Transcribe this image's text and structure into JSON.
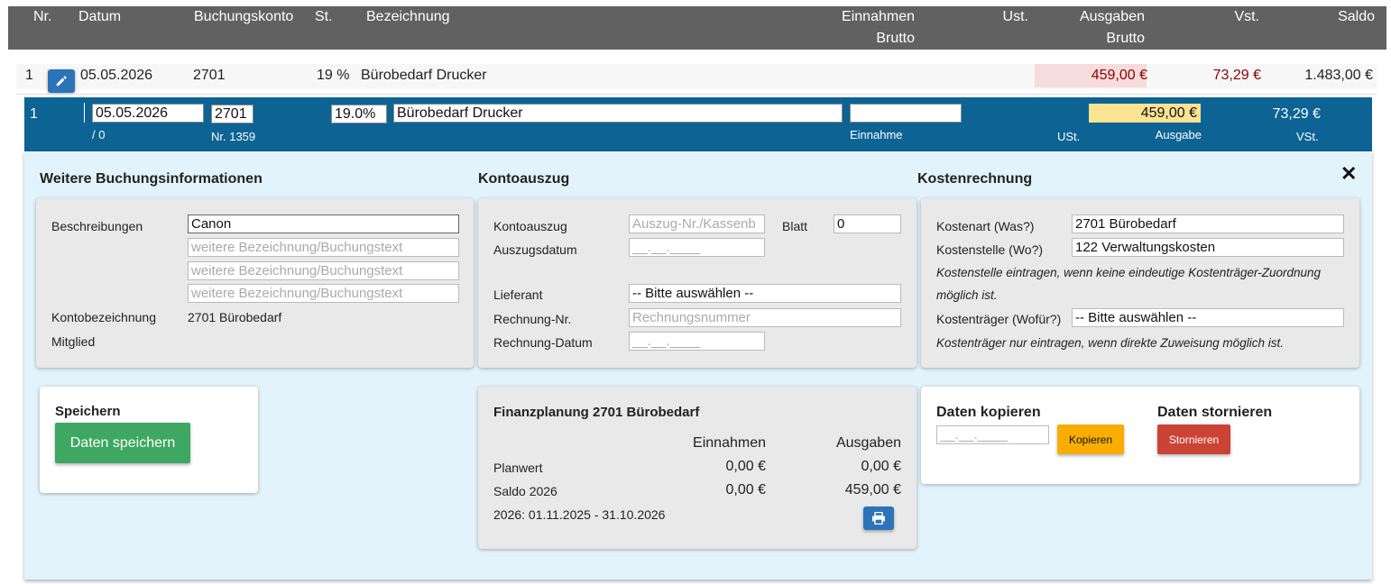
{
  "header": {
    "nr": "Nr.",
    "datum": "Datum",
    "buchungskonto": "Buchungskonto",
    "st": "St.",
    "bezeichnung": "Bezeichnung",
    "einnahmen": "Einnahmen",
    "einnahmen_brutto": "Brutto",
    "ust": "Ust.",
    "ausgaben": "Ausgaben",
    "ausgaben_brutto": "Brutto",
    "vst": "Vst.",
    "saldo": "Saldo"
  },
  "row": {
    "nr": "1",
    "datum": "05.05.2026",
    "konto": "2701",
    "steuer": "19 %",
    "bezeichnung": "Bürobedarf Drucker",
    "ausgaben": "459,00 €",
    "vst": "73,29 €",
    "saldo": "1.483,00 €"
  },
  "edit": {
    "nr": "1",
    "datum": "05.05.2026",
    "sub_datum": "/ 0",
    "konto": "2701",
    "konto_nr": "Nr. 1359",
    "steuer": "19.0%",
    "bezeichnung": "Bürobedarf Drucker",
    "einnahme": "",
    "einnahme_label": "Einnahme",
    "ust_label": "USt.",
    "ausgabe": "459,00 €",
    "ausgabe_label": "Ausgabe",
    "vst_value": "73,29 €",
    "vst_label": "VSt."
  },
  "weitere": {
    "title": "Weitere Buchungsinformationen",
    "beschreibungen_label": "Beschreibungen",
    "beschreibung1": "Canon",
    "placeholder": "weitere Bezeichnung/Buchungstext",
    "kontobezeichnung_label": "Kontobezeichnung",
    "kontobezeichnung_value": "2701 Bürobedarf",
    "mitglied_label": "Mitglied"
  },
  "kontoauszug": {
    "title": "Kontoauszug",
    "kontoauszug_label": "Kontoauszug",
    "kontoauszug_placeholder": "Auszug-Nr./Kassenb",
    "blatt_label": "Blatt",
    "blatt_value": "0",
    "auszugsdatum_label": "Auszugsdatum",
    "date_placeholder": "__.__.____",
    "lieferant_label": "Lieferant",
    "lieferant_value": "-- Bitte auswählen --",
    "rechnung_nr_label": "Rechnung-Nr.",
    "rechnung_nr_placeholder": "Rechnungsnummer",
    "rechnung_datum_label": "Rechnung-Datum"
  },
  "kosten": {
    "title": "Kostenrechnung",
    "kostenart_label": "Kostenart (Was?)",
    "kostenart_value": "2701 Bürobedarf",
    "kostenstelle_label": "Kostenstelle (Wo?)",
    "kostenstelle_value": "122 Verwaltungskosten",
    "hint1a": "Kostenstelle eintragen, wenn keine eindeutige Kostenträger-Zuordnung",
    "hint1b": "möglich ist.",
    "kostentraeger_label": "Kostenträger (Wofür?)",
    "kostentraeger_value": "-- Bitte auswählen --",
    "hint2": "Kostenträger nur eintragen, wenn direkte Zuweisung möglich ist."
  },
  "speichern": {
    "title": "Speichern",
    "button": "Daten speichern"
  },
  "finanz": {
    "title": "Finanzplanung 2701 Bürobedarf",
    "col_einnahmen": "Einnahmen",
    "col_ausgaben": "Ausgaben",
    "planwert_label": "Planwert",
    "planwert_ein": "0,00 €",
    "planwert_aus": "0,00 €",
    "saldo_label": "Saldo 2026",
    "saldo_ein": "0,00 €",
    "saldo_aus": "459,00 €",
    "period": "2026: 01.11.2025 - 31.10.2026"
  },
  "kopieren": {
    "title": "Daten kopieren",
    "date_placeholder": "__.__.____",
    "button": "Kopieren"
  },
  "stornieren": {
    "title": "Daten stornieren",
    "button": "Stornieren"
  },
  "colors": {
    "header_bg": "#616161",
    "edit_row_bg": "#0c6394",
    "area_bg": "#e2f3fb",
    "save_green": "#3ea862",
    "copy_orange": "#f9ad03",
    "cancel_red": "#cb4335",
    "money_red": "#8b0000"
  },
  "icons": {
    "edit": "pencil-icon",
    "close": "close-icon",
    "print": "print-icon"
  }
}
